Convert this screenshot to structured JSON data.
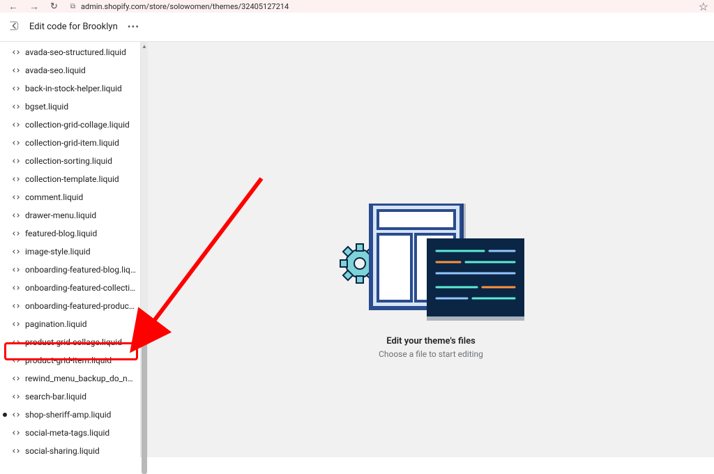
{
  "browser": {
    "url_prefix": "⧉",
    "url": "admin.shopify.com/store/solowomen/themes/32405127214"
  },
  "header": {
    "title": "Edit code for Brooklyn"
  },
  "sidebar": {
    "files": [
      {
        "label": "avada-seo-structured.liquid",
        "modified": false
      },
      {
        "label": "avada-seo.liquid",
        "modified": false
      },
      {
        "label": "back-in-stock-helper.liquid",
        "modified": false
      },
      {
        "label": "bgset.liquid",
        "modified": false
      },
      {
        "label": "collection-grid-collage.liquid",
        "modified": false
      },
      {
        "label": "collection-grid-item.liquid",
        "modified": false
      },
      {
        "label": "collection-sorting.liquid",
        "modified": false
      },
      {
        "label": "collection-template.liquid",
        "modified": false
      },
      {
        "label": "comment.liquid",
        "modified": false
      },
      {
        "label": "drawer-menu.liquid",
        "modified": false
      },
      {
        "label": "featured-blog.liquid",
        "modified": false
      },
      {
        "label": "image-style.liquid",
        "modified": false
      },
      {
        "label": "onboarding-featured-blog.liquid",
        "modified": false
      },
      {
        "label": "onboarding-featured-collections.l…",
        "modified": false
      },
      {
        "label": "onboarding-featured-products.liq…",
        "modified": false
      },
      {
        "label": "pagination.liquid",
        "modified": false
      },
      {
        "label": "product-grid-collage.liquid",
        "modified": false
      },
      {
        "label": "product-grid-item.liquid",
        "modified": false
      },
      {
        "label": "rewind_menu_backup_do_not_del…",
        "modified": false
      },
      {
        "label": "search-bar.liquid",
        "modified": false
      },
      {
        "label": "shop-sheriff-amp.liquid",
        "modified": true
      },
      {
        "label": "social-meta-tags.liquid",
        "modified": false
      },
      {
        "label": "social-sharing.liquid",
        "modified": false
      }
    ]
  },
  "empty": {
    "title": "Edit your theme's files",
    "sub": "Choose a file to start editing"
  },
  "annotation": {
    "highlight_index": 17
  }
}
